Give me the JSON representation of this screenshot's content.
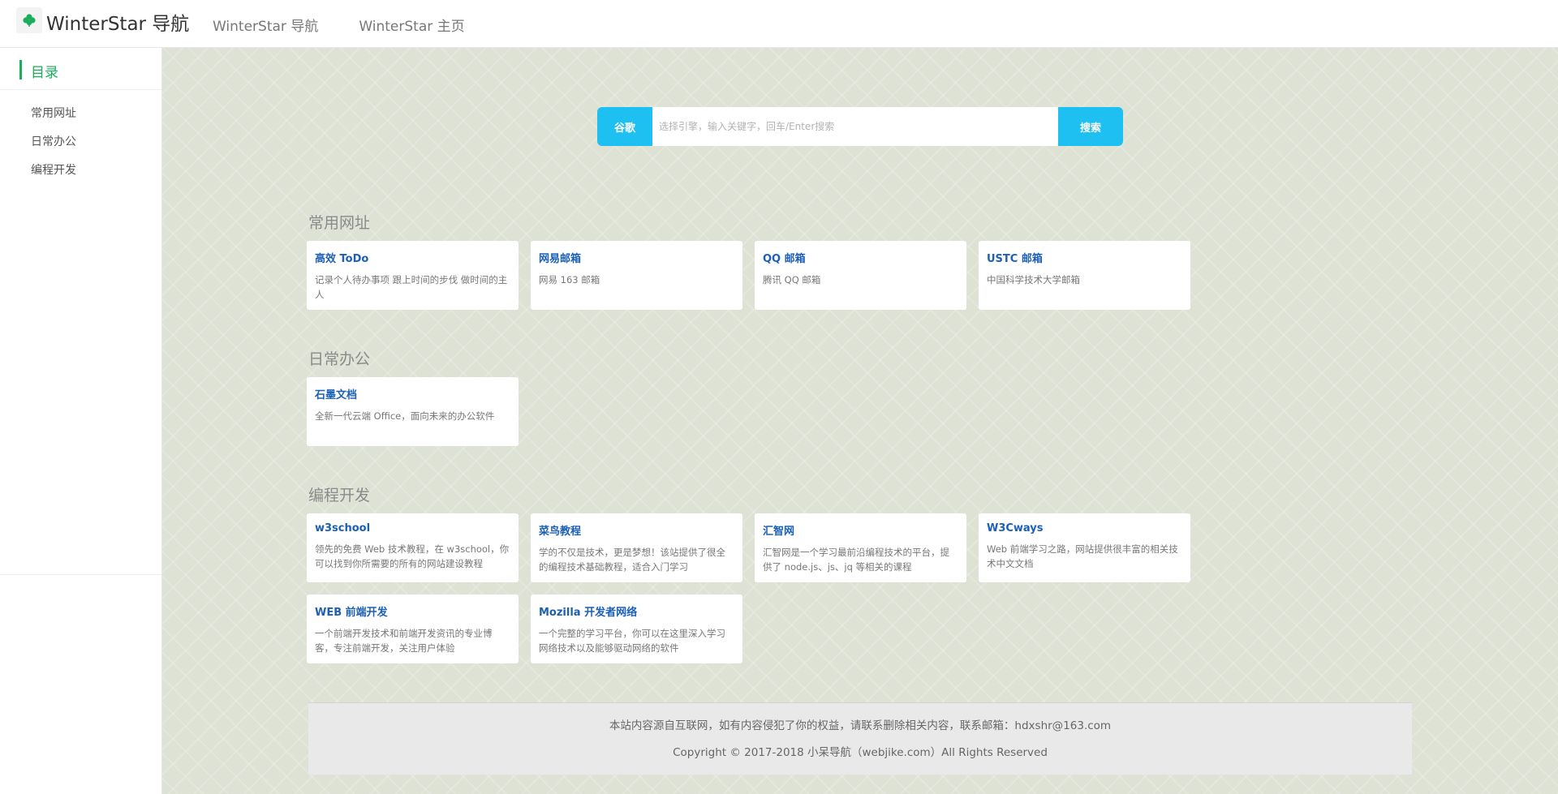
{
  "header": {
    "brand": "WinterStar 导航",
    "logo_icon": "clover-icon",
    "nav": [
      "WinterStar 导航",
      "WinterStar 主页"
    ]
  },
  "sidebar": {
    "title": "目录",
    "items": [
      "常用网址",
      "日常办公",
      "编程开发"
    ],
    "accent": "#1aad5b"
  },
  "search": {
    "engine": "谷歌",
    "placeholder": "选择引擎，输入关键字，回车/Enter搜索",
    "button": "搜索",
    "color": "#1ec0f2"
  },
  "sections": [
    {
      "title": "常用网址",
      "cards": [
        {
          "title": "高效 ToDo",
          "desc": "记录个人待办事项 跟上时间的步伐 做时间的主人"
        },
        {
          "title": "网易邮箱",
          "desc": "网易 163 邮箱"
        },
        {
          "title": "QQ 邮箱",
          "desc": "腾讯 QQ 邮箱"
        },
        {
          "title": "USTC 邮箱",
          "desc": "中国科学技术大学邮箱"
        }
      ]
    },
    {
      "title": "日常办公",
      "cards": [
        {
          "title": "石墨文档",
          "desc": "全新一代云端 Office，面向未来的办公软件"
        }
      ]
    },
    {
      "title": "编程开发",
      "cards": [
        {
          "title": "w3school",
          "desc": "领先的免费 Web 技术教程，在 w3school，你可以找到你所需要的所有的网站建设教程"
        },
        {
          "title": "菜鸟教程",
          "desc": "学的不仅是技术，更是梦想！该站提供了很全的编程技术基础教程，适合入门学习"
        },
        {
          "title": "汇智网",
          "desc": "汇智网是一个学习最前沿编程技术的平台，提供了 node.js、js、jq 等相关的课程"
        },
        {
          "title": "W3Cways",
          "desc": "Web 前端学习之路，网站提供很丰富的相关技术中文文档"
        },
        {
          "title": "WEB 前端开发",
          "desc": "一个前端开发技术和前端开发资讯的专业博客，专注前端开发，关注用户体验"
        },
        {
          "title": "Mozilla 开发者网络",
          "desc": "一个完整的学习平台，你可以在这里深入学习网络技术以及能够驱动网络的软件"
        }
      ]
    }
  ],
  "footer": {
    "line1": "本站内容源自互联网，如有内容侵犯了你的权益，请联系删除相关内容，联系邮箱：hdxshr@163.com",
    "line2": "Copyright © 2017-2018 小呆导航（webjike.com）All Rights Reserved"
  }
}
